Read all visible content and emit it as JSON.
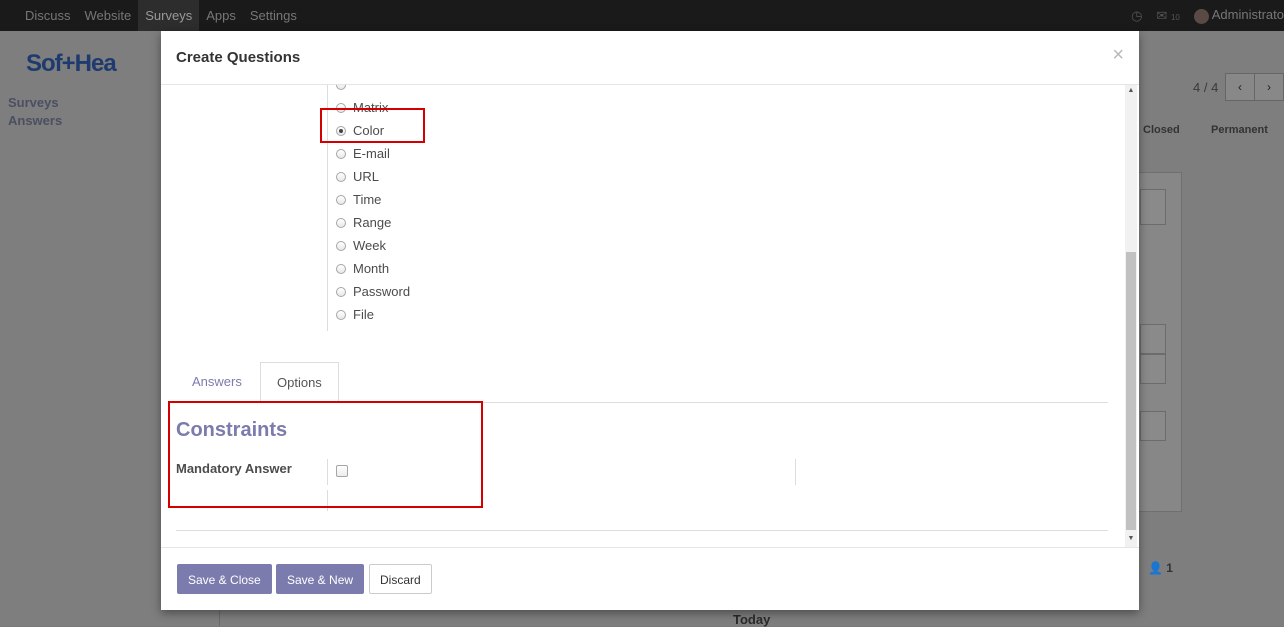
{
  "topbar": {
    "menu": [
      "Discuss",
      "Website",
      "Surveys",
      "Apps",
      "Settings"
    ],
    "active_menu": "Surveys",
    "clock_icon": "clock-icon",
    "chat_icon": "chat-icon",
    "chat_count": "10",
    "user": "Administrato"
  },
  "background": {
    "logo": "Sof+Hea",
    "sidebar": [
      "Surveys",
      "Answers"
    ],
    "pager": "4 / 4",
    "pager_prev": "‹",
    "pager_next": "›",
    "status_closed": "Closed",
    "status_permanent": "Permanent",
    "follower_count": "1",
    "today_label": "Today"
  },
  "modal": {
    "title": "Create Questions",
    "close": "×",
    "question_types": [
      {
        "label": "",
        "checked": false
      },
      {
        "label": "Matrix",
        "checked": false
      },
      {
        "label": "Color",
        "checked": true
      },
      {
        "label": "E-mail",
        "checked": false
      },
      {
        "label": "URL",
        "checked": false
      },
      {
        "label": "Time",
        "checked": false
      },
      {
        "label": "Range",
        "checked": false
      },
      {
        "label": "Week",
        "checked": false
      },
      {
        "label": "Month",
        "checked": false
      },
      {
        "label": "Password",
        "checked": false
      },
      {
        "label": "File",
        "checked": false
      }
    ],
    "tabs": {
      "answers": "Answers",
      "options": "Options"
    },
    "section_title": "Constraints",
    "mandatory_label": "Mandatory Answer",
    "mandatory_checked": false,
    "buttons": {
      "save_close": "Save & Close",
      "save_new": "Save & New",
      "discard": "Discard"
    }
  },
  "colors": {
    "accent": "#7c7bad",
    "highlight": "#d40000"
  }
}
